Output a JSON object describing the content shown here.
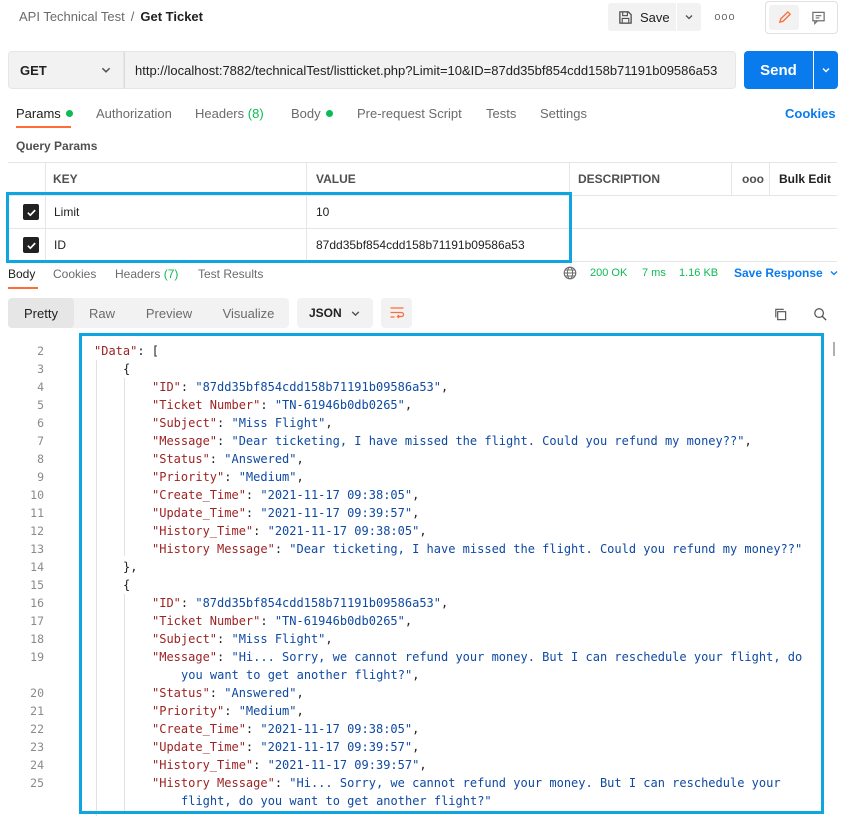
{
  "header": {
    "collection": "API Technical Test",
    "separator": "/",
    "request_name": "Get Ticket",
    "save_label": "Save",
    "more_label": "ooo"
  },
  "request": {
    "method": "GET",
    "url": "http://localhost:7882/technicalTest/listticket.php?Limit=10&ID=87dd35bf854cdd158b71191b09586a53",
    "send_label": "Send"
  },
  "tabs": {
    "params": "Params",
    "authorization": "Authorization",
    "headers": "Headers",
    "headers_count": "(8)",
    "body": "Body",
    "prerequest": "Pre-request Script",
    "tests": "Tests",
    "settings": "Settings",
    "cookies": "Cookies"
  },
  "query_params": {
    "section_label": "Query Params",
    "columns": {
      "key": "KEY",
      "value": "VALUE",
      "description": "DESCRIPTION",
      "more": "ooo",
      "bulk_edit": "Bulk Edit"
    },
    "rows": [
      {
        "key": "Limit",
        "value": "10",
        "checked": true
      },
      {
        "key": "ID",
        "value": "87dd35bf854cdd158b71191b09586a53",
        "checked": true
      }
    ]
  },
  "response_tabs": {
    "body": "Body",
    "cookies": "Cookies",
    "headers": "Headers",
    "headers_count": "(7)",
    "test_results": "Test Results",
    "status": "200 OK",
    "time": "7 ms",
    "size": "1.16 KB",
    "save_response": "Save Response"
  },
  "view": {
    "pretty": "Pretty",
    "raw": "Raw",
    "preview": "Preview",
    "visualize": "Visualize",
    "format": "JSON"
  },
  "code_lines": [
    {
      "ln": "2",
      "indent": 0,
      "parts": [
        [
          "k",
          "\"Data\""
        ],
        [
          "p",
          ": ["
        ]
      ]
    },
    {
      "ln": "3",
      "indent": 1,
      "parts": [
        [
          "p",
          "{"
        ]
      ]
    },
    {
      "ln": "4",
      "indent": 2,
      "parts": [
        [
          "k",
          "\"ID\""
        ],
        [
          "p",
          ": "
        ],
        [
          "s",
          "\"87dd35bf854cdd158b71191b09586a53\""
        ],
        [
          "p",
          ","
        ]
      ]
    },
    {
      "ln": "5",
      "indent": 2,
      "parts": [
        [
          "k",
          "\"Ticket Number\""
        ],
        [
          "p",
          ": "
        ],
        [
          "s",
          "\"TN-61946b0db0265\""
        ],
        [
          "p",
          ","
        ]
      ]
    },
    {
      "ln": "6",
      "indent": 2,
      "parts": [
        [
          "k",
          "\"Subject\""
        ],
        [
          "p",
          ": "
        ],
        [
          "s",
          "\"Miss Flight\""
        ],
        [
          "p",
          ","
        ]
      ]
    },
    {
      "ln": "7",
      "indent": 2,
      "parts": [
        [
          "k",
          "\"Message\""
        ],
        [
          "p",
          ": "
        ],
        [
          "s",
          "\"Dear ticketing, I have missed the flight. Could you refund my money??\""
        ],
        [
          "p",
          ","
        ]
      ]
    },
    {
      "ln": "8",
      "indent": 2,
      "parts": [
        [
          "k",
          "\"Status\""
        ],
        [
          "p",
          ": "
        ],
        [
          "s",
          "\"Answered\""
        ],
        [
          "p",
          ","
        ]
      ]
    },
    {
      "ln": "9",
      "indent": 2,
      "parts": [
        [
          "k",
          "\"Priority\""
        ],
        [
          "p",
          ": "
        ],
        [
          "s",
          "\"Medium\""
        ],
        [
          "p",
          ","
        ]
      ]
    },
    {
      "ln": "10",
      "indent": 2,
      "parts": [
        [
          "k",
          "\"Create_Time\""
        ],
        [
          "p",
          ": "
        ],
        [
          "s",
          "\"2021-11-17 09:38:05\""
        ],
        [
          "p",
          ","
        ]
      ]
    },
    {
      "ln": "11",
      "indent": 2,
      "parts": [
        [
          "k",
          "\"Update_Time\""
        ],
        [
          "p",
          ": "
        ],
        [
          "s",
          "\"2021-11-17 09:39:57\""
        ],
        [
          "p",
          ","
        ]
      ]
    },
    {
      "ln": "12",
      "indent": 2,
      "parts": [
        [
          "k",
          "\"History_Time\""
        ],
        [
          "p",
          ": "
        ],
        [
          "s",
          "\"2021-11-17 09:38:05\""
        ],
        [
          "p",
          ","
        ]
      ]
    },
    {
      "ln": "13",
      "indent": 2,
      "parts": [
        [
          "k",
          "\"History Message\""
        ],
        [
          "p",
          ": "
        ],
        [
          "s",
          "\"Dear ticketing, I have missed the flight. Could you refund my money??\""
        ]
      ]
    },
    {
      "ln": "14",
      "indent": 1,
      "parts": [
        [
          "p",
          "},"
        ]
      ]
    },
    {
      "ln": "15",
      "indent": 1,
      "parts": [
        [
          "p",
          "{"
        ]
      ]
    },
    {
      "ln": "16",
      "indent": 2,
      "parts": [
        [
          "k",
          "\"ID\""
        ],
        [
          "p",
          ": "
        ],
        [
          "s",
          "\"87dd35bf854cdd158b71191b09586a53\""
        ],
        [
          "p",
          ","
        ]
      ]
    },
    {
      "ln": "17",
      "indent": 2,
      "parts": [
        [
          "k",
          "\"Ticket Number\""
        ],
        [
          "p",
          ": "
        ],
        [
          "s",
          "\"TN-61946b0db0265\""
        ],
        [
          "p",
          ","
        ]
      ]
    },
    {
      "ln": "18",
      "indent": 2,
      "parts": [
        [
          "k",
          "\"Subject\""
        ],
        [
          "p",
          ": "
        ],
        [
          "s",
          "\"Miss Flight\""
        ],
        [
          "p",
          ","
        ]
      ]
    },
    {
      "ln": "19",
      "indent": 2,
      "parts": [
        [
          "k",
          "\"Message\""
        ],
        [
          "p",
          ": "
        ],
        [
          "s",
          "\"Hi... Sorry, we cannot refund your money. But I can reschedule your flight, do"
        ]
      ]
    },
    {
      "ln": "",
      "indent": 3,
      "parts": [
        [
          "s",
          "you want to get another flight?\""
        ],
        [
          "p",
          ","
        ]
      ]
    },
    {
      "ln": "20",
      "indent": 2,
      "parts": [
        [
          "k",
          "\"Status\""
        ],
        [
          "p",
          ": "
        ],
        [
          "s",
          "\"Answered\""
        ],
        [
          "p",
          ","
        ]
      ]
    },
    {
      "ln": "21",
      "indent": 2,
      "parts": [
        [
          "k",
          "\"Priority\""
        ],
        [
          "p",
          ": "
        ],
        [
          "s",
          "\"Medium\""
        ],
        [
          "p",
          ","
        ]
      ]
    },
    {
      "ln": "22",
      "indent": 2,
      "parts": [
        [
          "k",
          "\"Create_Time\""
        ],
        [
          "p",
          ": "
        ],
        [
          "s",
          "\"2021-11-17 09:38:05\""
        ],
        [
          "p",
          ","
        ]
      ]
    },
    {
      "ln": "23",
      "indent": 2,
      "parts": [
        [
          "k",
          "\"Update_Time\""
        ],
        [
          "p",
          ": "
        ],
        [
          "s",
          "\"2021-11-17 09:39:57\""
        ],
        [
          "p",
          ","
        ]
      ]
    },
    {
      "ln": "24",
      "indent": 2,
      "parts": [
        [
          "k",
          "\"History_Time\""
        ],
        [
          "p",
          ": "
        ],
        [
          "s",
          "\"2021-11-17 09:39:57\""
        ],
        [
          "p",
          ","
        ]
      ]
    },
    {
      "ln": "25",
      "indent": 2,
      "parts": [
        [
          "k",
          "\"History Message\""
        ],
        [
          "p",
          ": "
        ],
        [
          "s",
          "\"Hi... Sorry, we cannot refund your money. But I can reschedule your"
        ]
      ]
    },
    {
      "ln": "",
      "indent": 3,
      "parts": [
        [
          "s",
          "flight, do you want to get another flight?\""
        ]
      ]
    }
  ]
}
